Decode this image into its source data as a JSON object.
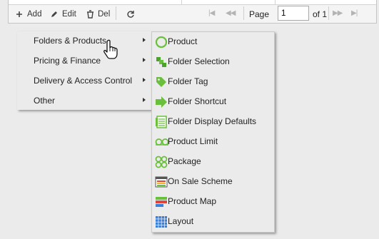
{
  "toolbar": {
    "add_label": "Add",
    "edit_label": "Edit",
    "delete_label": "Del",
    "page_label": "Page",
    "page_value": "1",
    "page_of": "of 1"
  },
  "context_menu": {
    "items": [
      {
        "label": "Folders & Products"
      },
      {
        "label": "Pricing & Finance"
      },
      {
        "label": "Delivery & Access Control"
      },
      {
        "label": "Other"
      }
    ]
  },
  "submenu": {
    "items": [
      {
        "label": "Product",
        "icon": "circle-ring-icon"
      },
      {
        "label": "Folder Selection",
        "icon": "folder-selection-icon"
      },
      {
        "label": "Folder Tag",
        "icon": "tag-icon"
      },
      {
        "label": "Folder Shortcut",
        "icon": "arrow-right-icon"
      },
      {
        "label": "Folder Display Defaults",
        "icon": "document-lines-icon"
      },
      {
        "label": "Product Limit",
        "icon": "double-circle-icon"
      },
      {
        "label": "Package",
        "icon": "four-circles-icon"
      },
      {
        "label": "On Sale Scheme",
        "icon": "scheme-icon"
      },
      {
        "label": "Product Map",
        "icon": "map-bars-icon"
      },
      {
        "label": "Layout",
        "icon": "grid-icon"
      }
    ]
  },
  "colors": {
    "green": "#6abf3c",
    "red": "#e0443a",
    "blue": "#3b7fd9"
  }
}
